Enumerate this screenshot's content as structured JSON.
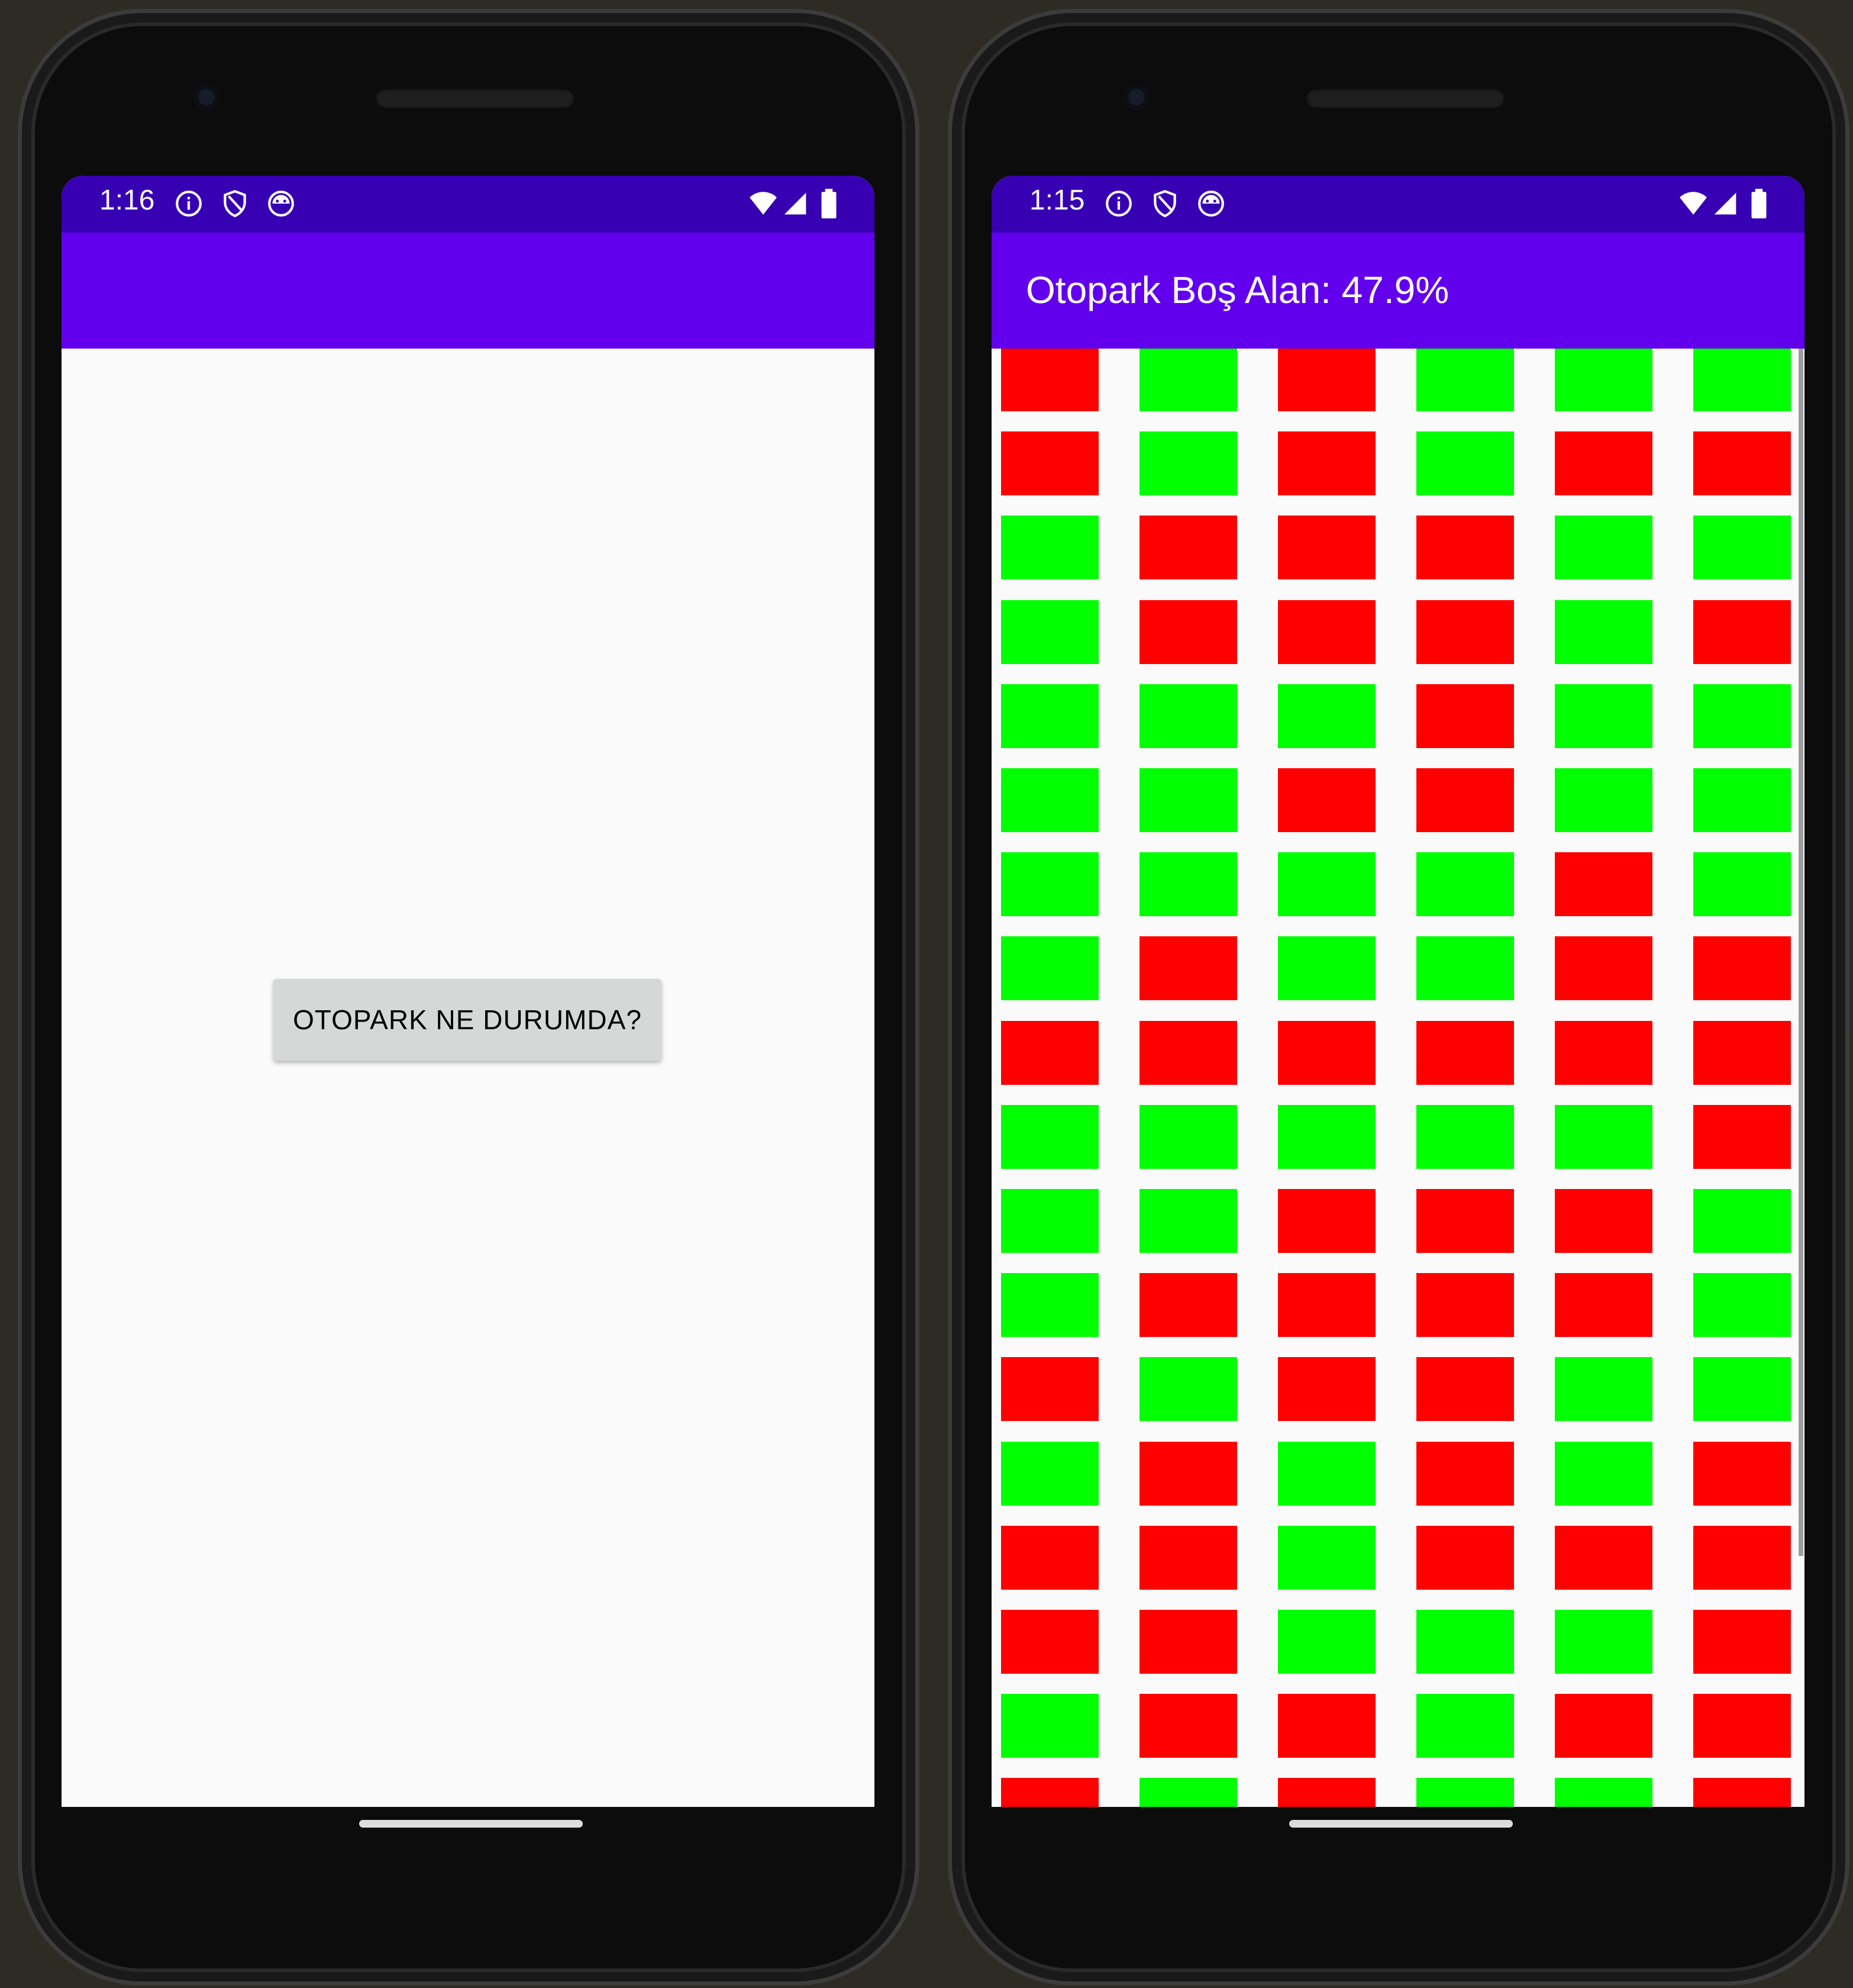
{
  "left_phone": {
    "statusbar": {
      "time": "1:16",
      "icons": [
        "info-icon",
        "shield-icon",
        "android-icon",
        "wifi-icon",
        "signal-icon",
        "battery-icon"
      ]
    },
    "appbar": {
      "title": ""
    },
    "button": {
      "label": "OTOPARK NE DURUMDA?"
    }
  },
  "right_phone": {
    "statusbar": {
      "time": "1:15",
      "icons": [
        "info-icon",
        "shield-icon",
        "android-icon",
        "wifi-icon",
        "signal-icon",
        "battery-icon"
      ]
    },
    "appbar": {
      "title": "Otopark Boş Alan: 47.9%"
    },
    "parking_grid": {
      "columns": 6,
      "colors": {
        "occupied": "#ff0000",
        "empty": "#00ff00"
      },
      "rows": [
        [
          "occupied",
          "empty",
          "occupied",
          "empty",
          "empty",
          "empty"
        ],
        [
          "occupied",
          "empty",
          "occupied",
          "empty",
          "occupied",
          "occupied"
        ],
        [
          "empty",
          "occupied",
          "occupied",
          "occupied",
          "empty",
          "empty"
        ],
        [
          "empty",
          "occupied",
          "occupied",
          "occupied",
          "empty",
          "occupied"
        ],
        [
          "empty",
          "empty",
          "empty",
          "occupied",
          "empty",
          "empty"
        ],
        [
          "empty",
          "empty",
          "occupied",
          "occupied",
          "empty",
          "empty"
        ],
        [
          "empty",
          "empty",
          "empty",
          "empty",
          "occupied",
          "empty"
        ],
        [
          "empty",
          "occupied",
          "empty",
          "empty",
          "occupied",
          "occupied"
        ],
        [
          "occupied",
          "occupied",
          "occupied",
          "occupied",
          "occupied",
          "occupied"
        ],
        [
          "empty",
          "empty",
          "empty",
          "empty",
          "empty",
          "occupied"
        ],
        [
          "empty",
          "empty",
          "occupied",
          "occupied",
          "occupied",
          "empty"
        ],
        [
          "empty",
          "occupied",
          "occupied",
          "occupied",
          "occupied",
          "empty"
        ],
        [
          "occupied",
          "empty",
          "occupied",
          "occupied",
          "empty",
          "empty"
        ],
        [
          "empty",
          "occupied",
          "empty",
          "occupied",
          "empty",
          "occupied"
        ],
        [
          "occupied",
          "occupied",
          "empty",
          "occupied",
          "occupied",
          "occupied"
        ],
        [
          "occupied",
          "occupied",
          "empty",
          "empty",
          "empty",
          "occupied"
        ],
        [
          "empty",
          "occupied",
          "occupied",
          "empty",
          "occupied",
          "occupied"
        ],
        [
          "occupied",
          "empty",
          "occupied",
          "empty",
          "empty",
          "occupied"
        ]
      ]
    }
  },
  "theme": {
    "statusbar": "#3700b3",
    "appbar": "#6200ee",
    "background": "#fafafa",
    "button": "#d6d7d7"
  }
}
